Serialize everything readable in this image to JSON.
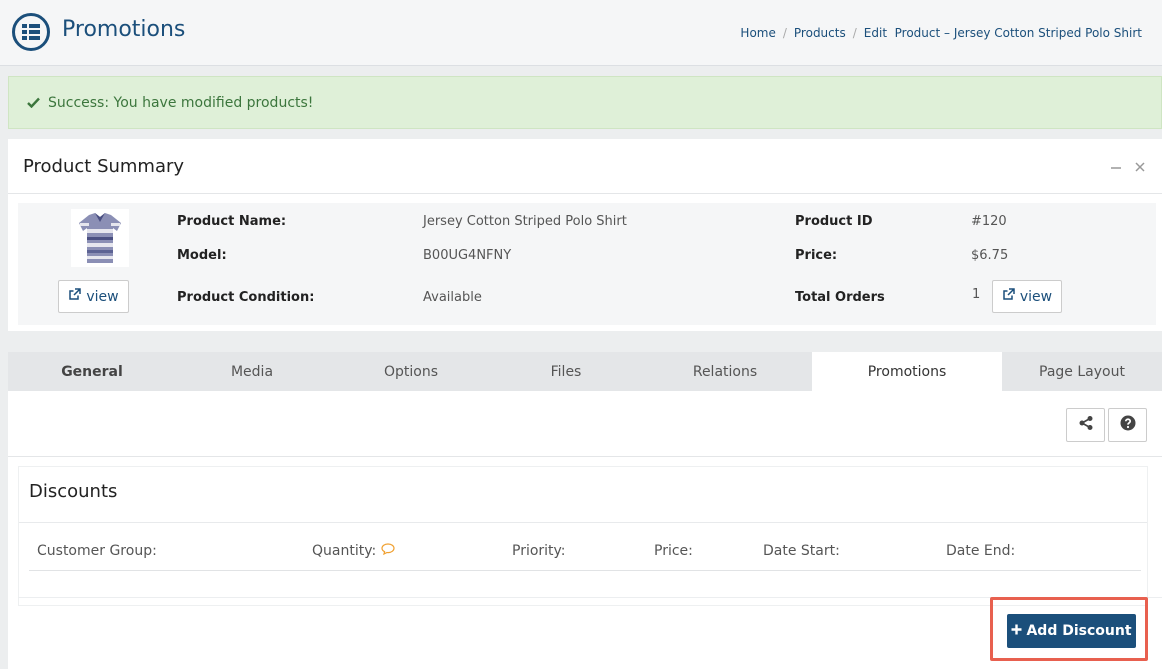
{
  "header": {
    "title": "Promotions",
    "breadcrumb": [
      "Home",
      "Products",
      "Edit  Product – Jersey Cotton Striped Polo Shirt"
    ]
  },
  "alert": {
    "message": "Success: You have modified products!"
  },
  "summary": {
    "title": "Product Summary",
    "view_label": "view",
    "product_name_label": "Product Name:",
    "product_name": "Jersey Cotton Striped Polo Shirt",
    "model_label": "Model:",
    "model": "B00UG4NFNY",
    "condition_label": "Product Condition:",
    "condition": "Available",
    "product_id_label": "Product ID",
    "product_id": "#120",
    "price_label": "Price:",
    "price": "$6.75",
    "orders_label": "Total Orders",
    "orders": "1"
  },
  "tabs": [
    {
      "label": "General"
    },
    {
      "label": "Media"
    },
    {
      "label": "Options"
    },
    {
      "label": "Files"
    },
    {
      "label": "Relations"
    },
    {
      "label": "Promotions"
    },
    {
      "label": "Page Layout"
    }
  ],
  "discounts": {
    "title": "Discounts",
    "columns": [
      "Customer Group:",
      "Quantity:",
      "Priority:",
      "Price:",
      "Date Start:",
      "Date End:"
    ],
    "add_label": "Add Discount"
  },
  "colors": {
    "brand": "#1b4f7b",
    "success_bg": "#dff0d8",
    "success_text": "#3c763d",
    "highlight": "#e8604f",
    "tooltip_icon": "#f0a030"
  },
  "icons": [
    "list-circle-icon",
    "check-icon",
    "minimize-icon",
    "close-icon",
    "external-link-icon",
    "share-icon",
    "help-icon",
    "comment-icon",
    "plus-icon"
  ]
}
